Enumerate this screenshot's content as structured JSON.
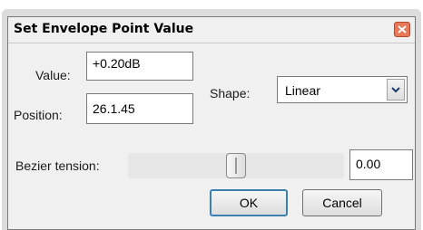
{
  "dialog": {
    "title": "Set Envelope Point Value",
    "close_icon": "close-icon"
  },
  "fields": {
    "value_label": "Value:",
    "value": "+0.20dB",
    "position_label": "Position:",
    "position": "26.1.45",
    "shape_label": "Shape:",
    "shape_value": "Linear",
    "bezier_label": "Bezier tension:",
    "bezier_value": "0.00",
    "bezier_slider_level": 0.5
  },
  "buttons": {
    "ok": "OK",
    "cancel": "Cancel"
  },
  "colors": {
    "close_button": "#e8785a",
    "default_button_border": "#3c7fb1"
  }
}
